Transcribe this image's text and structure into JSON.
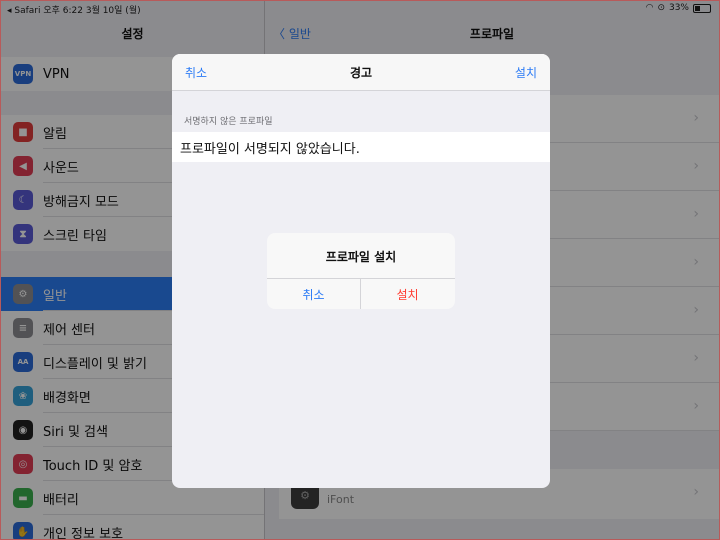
{
  "status": {
    "left": "◂ Safari  오후 6:22   3월 10일 (월)",
    "battery": "33%",
    "battery_level": 0.33
  },
  "left_panel": {
    "title": "설정",
    "groups": [
      [
        {
          "label": "VPN",
          "icon": "vpn-icon",
          "color": "#2b6bd9",
          "glyph": "VPN"
        }
      ],
      [
        {
          "label": "알림",
          "icon": "notification-icon",
          "color": "#e23d3d",
          "glyph": "■"
        },
        {
          "label": "사운드",
          "icon": "sound-icon",
          "color": "#e23d55",
          "glyph": "◀"
        },
        {
          "label": "방해금지 모드",
          "icon": "moon-icon",
          "color": "#5b5bd6",
          "glyph": "☾"
        },
        {
          "label": "스크린 타임",
          "icon": "hourglass-icon",
          "color": "#5b5bd6",
          "glyph": "⧗"
        }
      ],
      [
        {
          "label": "일반",
          "icon": "gear-icon",
          "color": "#8e8e93",
          "glyph": "⚙",
          "selected": true
        },
        {
          "label": "제어 센터",
          "icon": "control-center-icon",
          "color": "#8e8e93",
          "glyph": "≡"
        },
        {
          "label": "디스플레이 및 밝기",
          "icon": "display-icon",
          "color": "#2b6bd9",
          "glyph": "AA"
        },
        {
          "label": "배경화면",
          "icon": "wallpaper-icon",
          "color": "#36a3d9",
          "glyph": "❀"
        },
        {
          "label": "Siri 및 검색",
          "icon": "siri-icon",
          "color": "#222",
          "glyph": "◉"
        },
        {
          "label": "Touch ID 및 암호",
          "icon": "fingerprint-icon",
          "color": "#e23d55",
          "glyph": "◎"
        },
        {
          "label": "배터리",
          "icon": "battery-icon",
          "color": "#3bb04f",
          "glyph": "▬"
        },
        {
          "label": "개인 정보 보호",
          "icon": "hand-icon",
          "color": "#2b6bd9",
          "glyph": "✋"
        }
      ]
    ]
  },
  "right_panel": {
    "back_label": "〈 일반",
    "title": "프로파일",
    "ifont_label": "iFont"
  },
  "sheet": {
    "cancel_label": "취소",
    "title": "경고",
    "install_label": "설치",
    "section_header": "서명하지 않은 프로파일",
    "section_text": "프로파일이 서명되지 않았습니다."
  },
  "alert": {
    "title": "프로파일 설치",
    "cancel_label": "취소",
    "install_label": "설치"
  }
}
